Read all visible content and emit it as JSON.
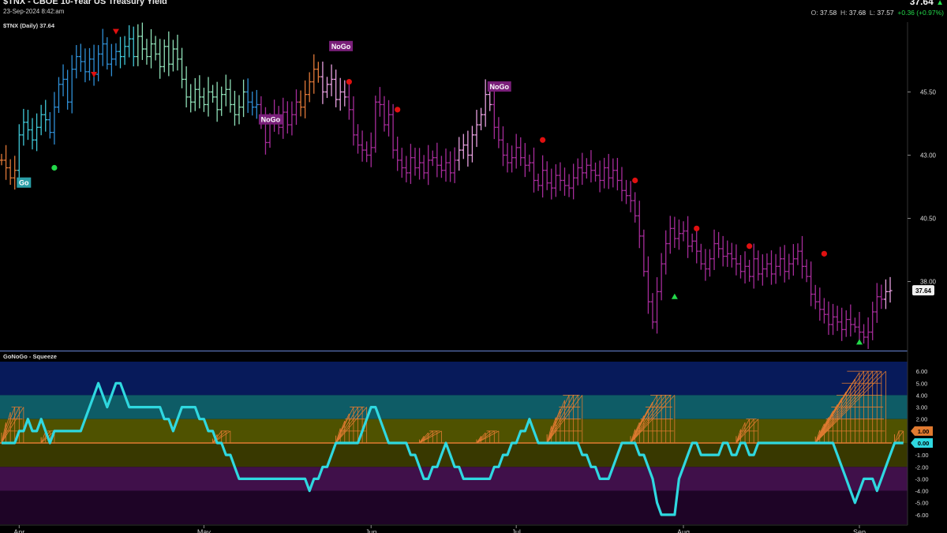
{
  "header": {
    "title": "$TNX - CBOE 10-Year US Treasury Yield",
    "date": "23-Sep-2024 8:42:am",
    "last": "37.64",
    "open_label": "O:",
    "open": "37.58",
    "high_label": "H:",
    "high": "37.68",
    "low_label": "L:",
    "low": "37.57",
    "change": "+0.36 (+0.97%)"
  },
  "colors": {
    "strong_go": "#2f8fd6",
    "go": "#40c8d8",
    "weak_go": "#8fe0b8",
    "weak_nogo": "#e07838",
    "nogo": "#a62c9a",
    "strong_nogo": "#e8a0e0",
    "oscillator": "#2fd8e0",
    "squeeze": "#e07a30",
    "divider": "#5a74b8"
  },
  "chart_data": [
    {
      "type": "ohlc",
      "legend": "$TNX (Daily) 37.64",
      "y_ticks": [
        "45.50",
        "43.00",
        "40.50",
        "38.00"
      ],
      "y_tick_values": [
        45.5,
        43.0,
        40.5,
        38.0
      ],
      "ylim": [
        35.3,
        48.2
      ],
      "last_label": "37.64",
      "x_ticks": [
        "Apr",
        "May",
        "Jun",
        "Jul",
        "Aug",
        "Sep"
      ],
      "x_tick_index": [
        4,
        46,
        84,
        117,
        155,
        195
      ],
      "closes": [
        42.8,
        42.5,
        42.1,
        42.4,
        43.8,
        44.3,
        44.0,
        43.6,
        44.1,
        44.6,
        44.4,
        43.9,
        44.9,
        45.8,
        46.0,
        45.1,
        46.4,
        46.9,
        46.7,
        46.3,
        46.8,
        46.2,
        47.0,
        47.4,
        46.6,
        46.8,
        47.1,
        46.9,
        47.3,
        47.6,
        46.9,
        47.7,
        47.2,
        46.9,
        47.4,
        47.0,
        46.5,
        47.3,
        46.6,
        47.2,
        46.8,
        46.0,
        45.3,
        45.1,
        45.6,
        45.3,
        45.0,
        45.5,
        45.3,
        44.8,
        45.4,
        45.6,
        45.0,
        44.6,
        44.9,
        45.5,
        45.1,
        44.9,
        45.0,
        44.3,
        43.5,
        44.4,
        44.6,
        44.1,
        44.7,
        44.2,
        44.6,
        45.1,
        44.9,
        45.4,
        45.9,
        46.4,
        46.1,
        45.5,
        45.8,
        46.0,
        45.2,
        45.5,
        45.3,
        44.8,
        43.8,
        43.4,
        43.2,
        43.0,
        43.3,
        45.1,
        45.0,
        44.2,
        44.6,
        43.2,
        42.8,
        42.5,
        42.3,
        42.9,
        42.5,
        42.7,
        42.3,
        42.8,
        42.9,
        42.6,
        42.4,
        42.7,
        42.3,
        42.8,
        43.2,
        43.4,
        43.0,
        43.8,
        44.2,
        44.6,
        45.4,
        45.0,
        44.1,
        43.6,
        43.0,
        42.7,
        42.9,
        43.3,
        42.9,
        42.6,
        42.7,
        42.0,
        41.8,
        42.4,
        41.9,
        41.7,
        42.2,
        42.0,
        41.8,
        41.7,
        42.1,
        42.5,
        42.3,
        42.6,
        42.4,
        42.2,
        42.0,
        42.5,
        42.1,
        42.4,
        42.0,
        41.6,
        41.4,
        41.2,
        40.6,
        39.8,
        38.4,
        37.2,
        36.4,
        37.6,
        38.7,
        39.5,
        40.1,
        39.7,
        39.9,
        40.0,
        39.4,
        39.6,
        39.2,
        38.7,
        38.5,
        38.9,
        39.5,
        39.3,
        39.0,
        39.1,
        38.9,
        38.7,
        38.4,
        38.6,
        38.2,
        38.9,
        38.3,
        38.5,
        38.7,
        38.3,
        38.6,
        38.9,
        38.4,
        38.7,
        38.9,
        39.2,
        38.6,
        38.2,
        37.5,
        37.2,
        36.9,
        36.7,
        36.3,
        36.6,
        36.4,
        36.1,
        36.5,
        36.3,
        36.2,
        36.0,
        35.8,
        36.0,
        36.8,
        37.4,
        37.3,
        37.6,
        37.64
      ],
      "color_regimes": [
        {
          "from": 0,
          "to": 3,
          "color": "weak_nogo"
        },
        {
          "from": 4,
          "to": 10,
          "color": "go"
        },
        {
          "from": 11,
          "to": 26,
          "color": "strong_go"
        },
        {
          "from": 27,
          "to": 30,
          "color": "go"
        },
        {
          "from": 31,
          "to": 41,
          "color": "weak_go"
        },
        {
          "from": 42,
          "to": 55,
          "color": "weak_go"
        },
        {
          "from": 56,
          "to": 58,
          "color": "strong_go"
        },
        {
          "from": 59,
          "to": 67,
          "color": "nogo"
        },
        {
          "from": 68,
          "to": 72,
          "color": "weak_nogo"
        },
        {
          "from": 73,
          "to": 78,
          "color": "strong_nogo"
        },
        {
          "from": 79,
          "to": 103,
          "color": "nogo"
        },
        {
          "from": 104,
          "to": 111,
          "color": "strong_nogo"
        },
        {
          "from": 112,
          "to": 200,
          "color": "nogo"
        },
        {
          "from": 201,
          "to": 205,
          "color": "strong_nogo"
        }
      ],
      "annotations": [
        {
          "text": "Go",
          "index": 4,
          "y": 41.9,
          "bg": "#2a9fa8"
        },
        {
          "text": "NoGo",
          "index": 59,
          "y": 44.4,
          "bg": "#7a1f7a"
        },
        {
          "text": "NoGo",
          "index": 75,
          "y": 47.3,
          "bg": "#7a1f7a"
        },
        {
          "text": "NoGo",
          "index": 111,
          "y": 45.7,
          "bg": "#7a1f7a"
        }
      ],
      "markers": [
        {
          "shape": "circle",
          "index": 12,
          "y": 42.5,
          "color": "#23d94a"
        },
        {
          "shape": "down",
          "index": 21,
          "y": 46.2,
          "color": "#e01010"
        },
        {
          "shape": "down",
          "index": 26,
          "y": 47.9,
          "color": "#e01010"
        },
        {
          "shape": "circle",
          "index": 79,
          "y": 45.9,
          "color": "#e01010"
        },
        {
          "shape": "circle",
          "index": 90,
          "y": 44.8,
          "color": "#e01010"
        },
        {
          "shape": "circle",
          "index": 123,
          "y": 43.6,
          "color": "#e01010"
        },
        {
          "shape": "circle",
          "index": 144,
          "y": 42.0,
          "color": "#e01010"
        },
        {
          "shape": "up",
          "index": 153,
          "y": 37.4,
          "color": "#23d94a"
        },
        {
          "shape": "circle",
          "index": 158,
          "y": 40.1,
          "color": "#e01010"
        },
        {
          "shape": "circle",
          "index": 170,
          "y": 39.4,
          "color": "#e01010"
        },
        {
          "shape": "circle",
          "index": 187,
          "y": 39.1,
          "color": "#e01010"
        },
        {
          "shape": "up",
          "index": 195,
          "y": 35.6,
          "color": "#23d94a"
        }
      ]
    },
    {
      "type": "line",
      "legend": "GoNoGo - Squeeze",
      "y_ticks": [
        "6.00",
        "5.00",
        "4.00",
        "3.00",
        "2.00",
        "1.00",
        "0.00",
        "-1.00",
        "-2.00",
        "-3.00",
        "-4.00",
        "-5.00",
        "-6.00"
      ],
      "y_tick_values": [
        6,
        5,
        4,
        3,
        2,
        1,
        0,
        -1,
        -2,
        -3,
        -4,
        -5,
        -6
      ],
      "ylim": [
        -6.8,
        6.8
      ],
      "squeeze_label": "1.00",
      "oscillator_label": "0.00",
      "bands": [
        {
          "from": 4,
          "to": 6.8,
          "color": "#071a5a"
        },
        {
          "from": 2,
          "to": 4,
          "color": "#0e5c66"
        },
        {
          "from": 0,
          "to": 2,
          "color": "#4f5200"
        },
        {
          "from": -2,
          "to": 0,
          "color": "#383800"
        },
        {
          "from": -4,
          "to": -2,
          "color": "#40104a"
        },
        {
          "from": -6.8,
          "to": -4,
          "color": "#1e0426"
        }
      ],
      "oscillator": [
        0,
        0,
        0,
        0,
        1,
        1,
        2,
        1,
        1,
        2,
        1,
        0,
        1,
        1,
        1,
        1,
        1,
        1,
        1,
        2,
        3,
        4,
        5,
        4,
        3,
        4,
        5,
        5,
        4,
        3,
        3,
        3,
        3,
        3,
        3,
        3,
        3,
        2,
        2,
        1,
        2,
        3,
        3,
        3,
        3,
        2,
        2,
        1,
        1,
        0,
        0,
        -1,
        -1,
        -2,
        -3,
        -3,
        -3,
        -3,
        -3,
        -3,
        -3,
        -3,
        -3,
        -3,
        -3,
        -3,
        -3,
        -3,
        -3,
        -3,
        -4,
        -3,
        -3,
        -2,
        -2,
        -1,
        0,
        0,
        0,
        0,
        0,
        0,
        1,
        2,
        3,
        3,
        2,
        1,
        0,
        0,
        0,
        0,
        0,
        -1,
        -1,
        -2,
        -3,
        -3,
        -2,
        -2,
        -1,
        0,
        -1,
        -2,
        -2,
        -3,
        -3,
        -3,
        -3,
        -3,
        -3,
        -3,
        -2,
        -2,
        -1,
        -1,
        0,
        0,
        1,
        1,
        2,
        1,
        0,
        0,
        0,
        0,
        0,
        0,
        0,
        0,
        0,
        0,
        -1,
        -1,
        -2,
        -2,
        -3,
        -3,
        -3,
        -2,
        -1,
        0,
        0,
        0,
        0,
        -1,
        -1,
        -2,
        -3,
        -5,
        -6,
        -6,
        -6,
        -6,
        -3,
        -2,
        -1,
        0,
        0,
        -1,
        -1,
        -1,
        -1,
        -1,
        0,
        0,
        -1,
        -1,
        0,
        0,
        -1,
        -1,
        0,
        0,
        0,
        0,
        0,
        0,
        0,
        0,
        0,
        0,
        0,
        0,
        0,
        0,
        0,
        0,
        0,
        0,
        -1,
        -2,
        -3,
        -4,
        -5,
        -4,
        -3,
        -3,
        -3,
        -4,
        -3,
        -2,
        -1,
        0,
        0,
        0
      ],
      "squeeze": [
        {
          "start": 0,
          "end": 5,
          "peak": 3
        },
        {
          "start": 9,
          "end": 12,
          "peak": 1
        },
        {
          "start": 48,
          "end": 52,
          "peak": 1
        },
        {
          "start": 76,
          "end": 83,
          "peak": 3
        },
        {
          "start": 95,
          "end": 100,
          "peak": 1
        },
        {
          "start": 108,
          "end": 113,
          "peak": 1
        },
        {
          "start": 124,
          "end": 132,
          "peak": 4
        },
        {
          "start": 143,
          "end": 153,
          "peak": 4
        },
        {
          "start": 167,
          "end": 172,
          "peak": 2
        },
        {
          "start": 185,
          "end": 201,
          "peak": 6
        },
        {
          "start": 203,
          "end": 205,
          "peak": 1
        }
      ]
    }
  ]
}
